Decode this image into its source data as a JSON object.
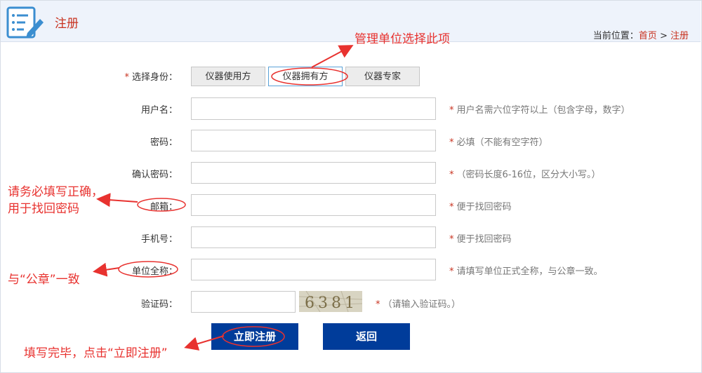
{
  "header": {
    "title": "注册",
    "breadcrumb_prefix": "当前位置：",
    "breadcrumb_home": "首页",
    "breadcrumb_sep": " > ",
    "breadcrumb_current": "注册"
  },
  "form": {
    "identity_label": "选择身份：",
    "identity_required": "*",
    "roles": [
      "仪器使用方",
      "仪器拥有方",
      "仪器专家"
    ],
    "selected_role": "仪器拥有方",
    "fields": [
      {
        "label": "用户名：",
        "value": "",
        "hint": "用户名需六位字符以上（包含字母，数字）"
      },
      {
        "label": "密码：",
        "value": "",
        "hint": "必填（不能有空字符）"
      },
      {
        "label": "确认密码：",
        "value": "",
        "hint": "（密码长度6-16位，区分大小写。）"
      },
      {
        "label": "邮箱：",
        "value": "",
        "hint": "便于找回密码"
      },
      {
        "label": "手机号：",
        "value": "",
        "hint": "便于找回密码"
      },
      {
        "label": "单位全称：",
        "value": "",
        "hint": "请填写单位正式全称，与公章一致。"
      }
    ],
    "captcha_label": "验证码：",
    "captcha_value": "",
    "captcha_text": "6381",
    "captcha_hint": "（请输入验证码。）",
    "hint_star": "*",
    "register_button": "立即注册",
    "back_button": "返回"
  },
  "annotations": {
    "role_note": "管理单位选择此项",
    "email_note_line1": "请务必填写正确，",
    "email_note_line2": "用于找回密码",
    "unit_note": "与“公章”一致",
    "submit_note": "填写完毕，点击“立即注册”"
  },
  "colors": {
    "accent_red": "#c8321f",
    "annotation_red": "#e8322f",
    "button_blue": "#003c9a",
    "header_bg": "#eef3fb",
    "active_border": "#5aa2d7"
  },
  "icons": {
    "logo": "checklist-pencil-icon"
  }
}
